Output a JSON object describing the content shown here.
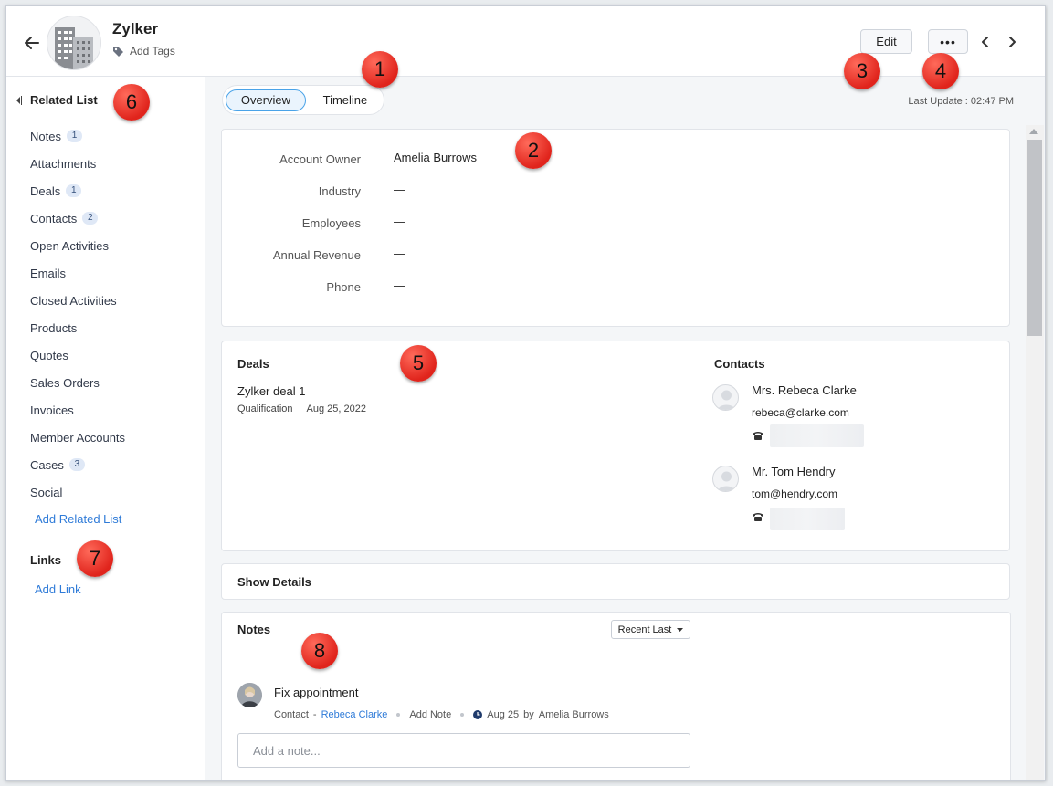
{
  "header": {
    "account_name": "Zylker",
    "add_tags_label": "Add Tags",
    "edit_label": "Edit",
    "more_label": "•••",
    "last_update": "Last Update : 02:47 PM"
  },
  "tabs": [
    {
      "label": "Overview",
      "active": true
    },
    {
      "label": "Timeline",
      "active": false
    }
  ],
  "sidebar": {
    "related_heading": "Related List",
    "items": [
      {
        "label": "Notes",
        "count": "1"
      },
      {
        "label": "Attachments",
        "count": null
      },
      {
        "label": "Deals",
        "count": "1"
      },
      {
        "label": "Contacts",
        "count": "2"
      },
      {
        "label": "Open Activities",
        "count": null
      },
      {
        "label": "Emails",
        "count": null
      },
      {
        "label": "Closed Activities",
        "count": null
      },
      {
        "label": "Products",
        "count": null
      },
      {
        "label": "Quotes",
        "count": null
      },
      {
        "label": "Sales Orders",
        "count": null
      },
      {
        "label": "Invoices",
        "count": null
      },
      {
        "label": "Member Accounts",
        "count": null
      },
      {
        "label": "Cases",
        "count": "3"
      },
      {
        "label": "Social",
        "count": null
      }
    ],
    "add_related_list": "Add Related List",
    "links_heading": "Links",
    "add_link": "Add Link"
  },
  "account_info": {
    "fields": [
      {
        "label": "Account Owner",
        "value": "Amelia Burrows"
      },
      {
        "label": "Industry",
        "value": "—"
      },
      {
        "label": "Employees",
        "value": "—"
      },
      {
        "label": "Annual Revenue",
        "value": "—"
      },
      {
        "label": "Phone",
        "value": "—"
      }
    ]
  },
  "deals": {
    "heading": "Deals",
    "items": [
      {
        "name": "Zylker deal 1",
        "stage": "Qualification",
        "date": "Aug 25, 2022"
      }
    ]
  },
  "contacts": {
    "heading": "Contacts",
    "items": [
      {
        "name": "Mrs. Rebeca Clarke",
        "email": "rebeca@clarke.com"
      },
      {
        "name": "Mr. Tom Hendry",
        "email": "tom@hendry.com"
      }
    ]
  },
  "show_details_label": "Show Details",
  "notes": {
    "heading": "Notes",
    "sort_label": "Recent Last",
    "items": [
      {
        "title": "Fix appointment",
        "type": "Contact",
        "separator": "-",
        "contact": "Rebeca Clarke",
        "action": "Add Note",
        "date": "Aug 25",
        "by": "by",
        "author": "Amelia Burrows"
      }
    ],
    "input_placeholder": "Add a note..."
  },
  "markers": [
    "1",
    "2",
    "3",
    "4",
    "5",
    "6",
    "7",
    "8"
  ],
  "colors": {
    "accent_link": "#2f7bd8",
    "tab_active_border": "#4aa3e8",
    "marker_red": "#e0241c",
    "badge_bg": "#dfe8f6"
  },
  "icons": {
    "back": "arrow-left-icon",
    "tag": "tag-icon",
    "prev": "chevron-left-icon",
    "next": "chevron-right-icon",
    "phone": "telephone-icon",
    "clock": "clock-icon",
    "sort": "caret-down-icon",
    "collapse": "collapse-left-icon"
  }
}
